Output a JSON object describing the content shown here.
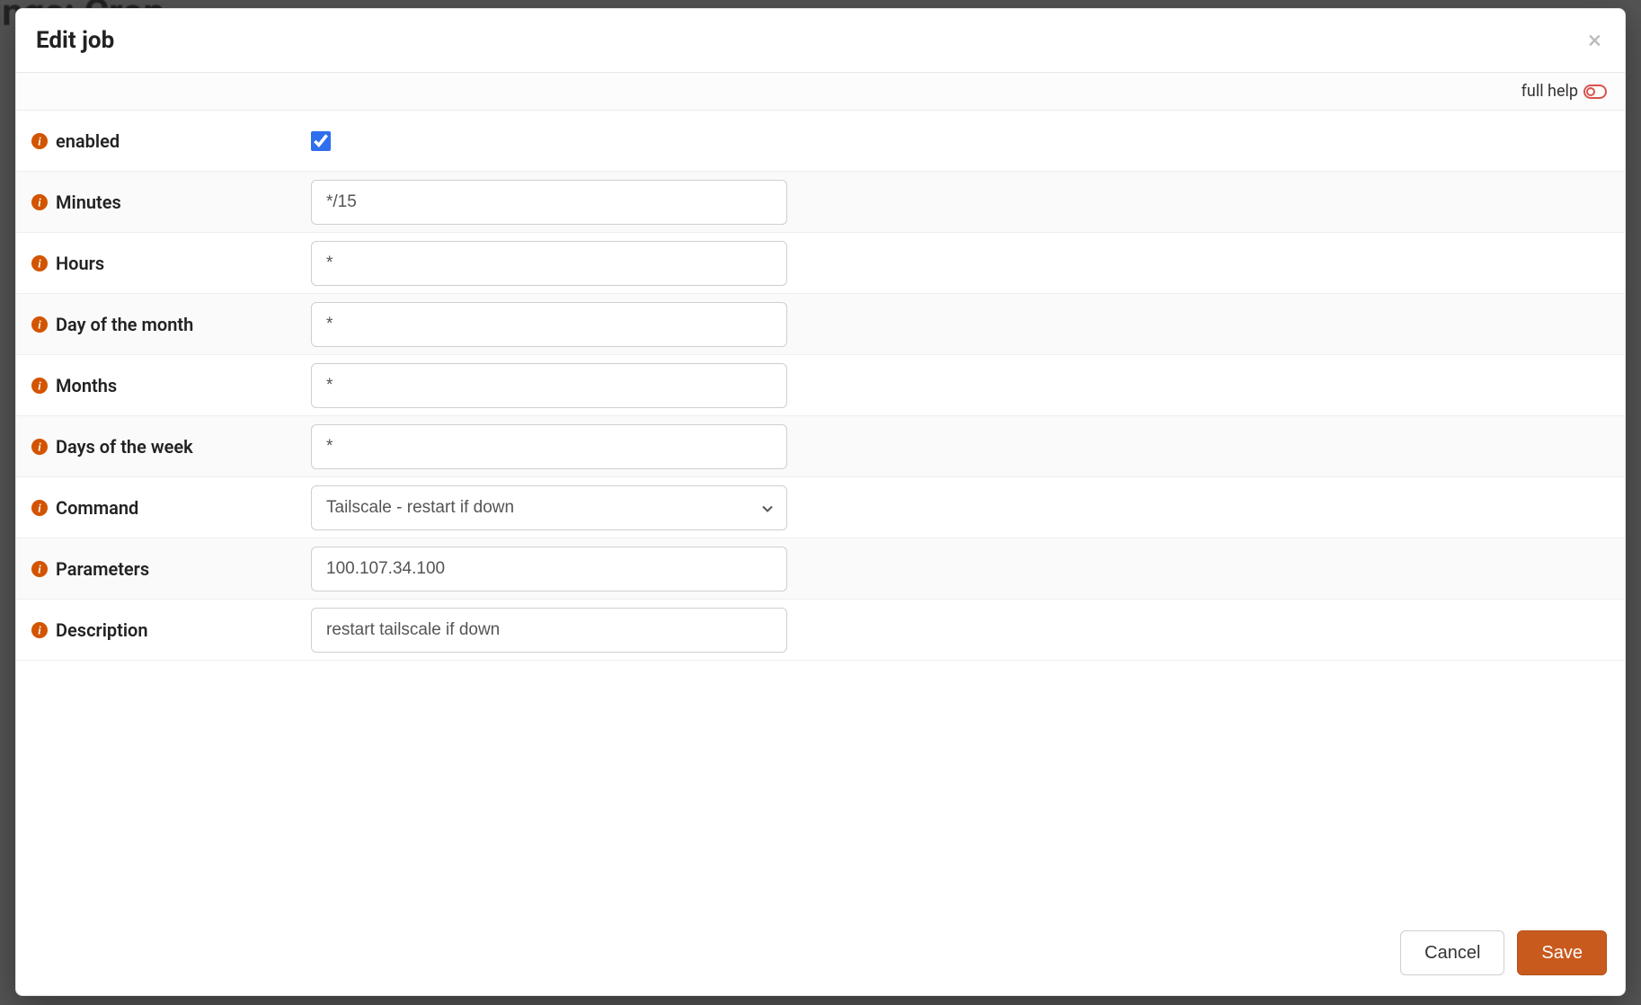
{
  "background_title": "ettings: Cron",
  "modal": {
    "title": "Edit job",
    "help_label": "full help",
    "fields": {
      "enabled": {
        "label": "enabled",
        "checked": true
      },
      "minutes": {
        "label": "Minutes",
        "value": "*/15"
      },
      "hours": {
        "label": "Hours",
        "value": "*"
      },
      "dom": {
        "label": "Day of the month",
        "value": "*"
      },
      "months": {
        "label": "Months",
        "value": "*"
      },
      "dow": {
        "label": "Days of the week",
        "value": "*"
      },
      "command": {
        "label": "Command",
        "value": "Tailscale - restart if down"
      },
      "params": {
        "label": "Parameters",
        "value": "100.107.34.100"
      },
      "descr": {
        "label": "Description",
        "value": "restart tailscale if down"
      }
    },
    "buttons": {
      "cancel": "Cancel",
      "save": "Save"
    }
  },
  "colors": {
    "accent": "#c95a1e",
    "info_icon": "#d35400"
  }
}
